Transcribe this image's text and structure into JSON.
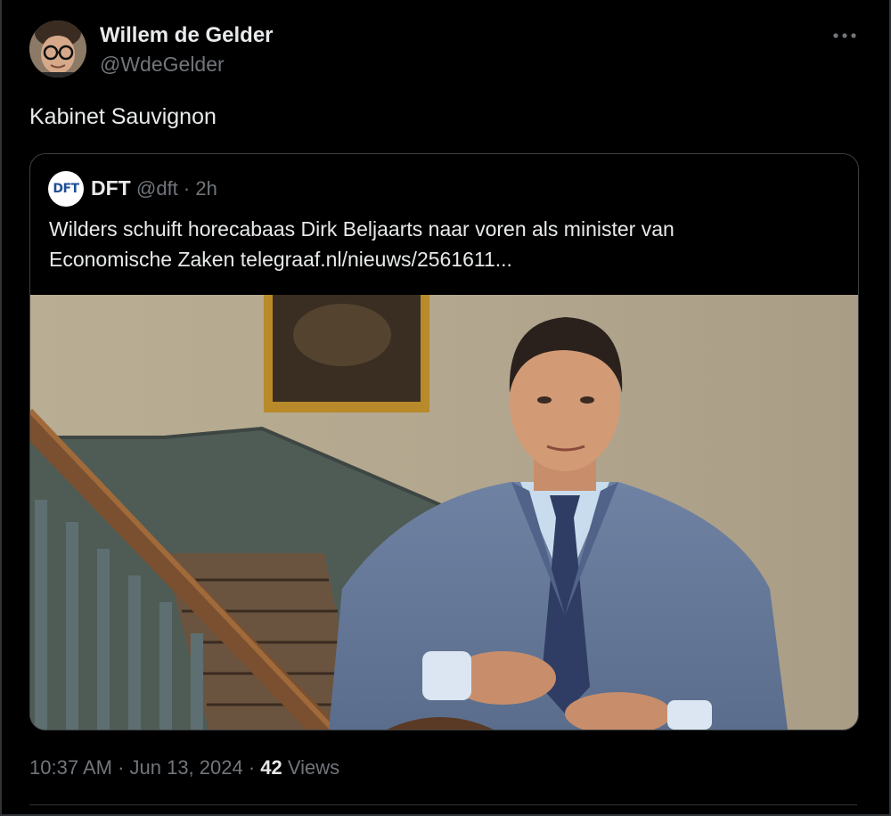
{
  "author": {
    "name": "Willem de Gelder",
    "handle": "@WdeGelder",
    "avatar_icon": "avatar-photo"
  },
  "more_icon": "more-horizontal-icon",
  "tweet": {
    "text": "Kabinet Sauvignon"
  },
  "quoted": {
    "avatar_label": "DFT",
    "name": "DFT",
    "handle_time": "@dft · 2h",
    "text_line1": "Wilders schuift horecabaas Dirk Beljaarts naar voren als minister van",
    "text_line2": "Economische Zaken telegraaf.nl/nieuws/2561611...",
    "image_description_icon": "news-photo"
  },
  "footer": {
    "timestamp": "10:37 AM · Jun 13, 2024 · ",
    "views_count": "42",
    "views_label": " Views"
  },
  "colors": {
    "background": "#000000",
    "text_primary": "#e7e9ea",
    "text_secondary": "#71767b",
    "border": "#2f3336"
  }
}
